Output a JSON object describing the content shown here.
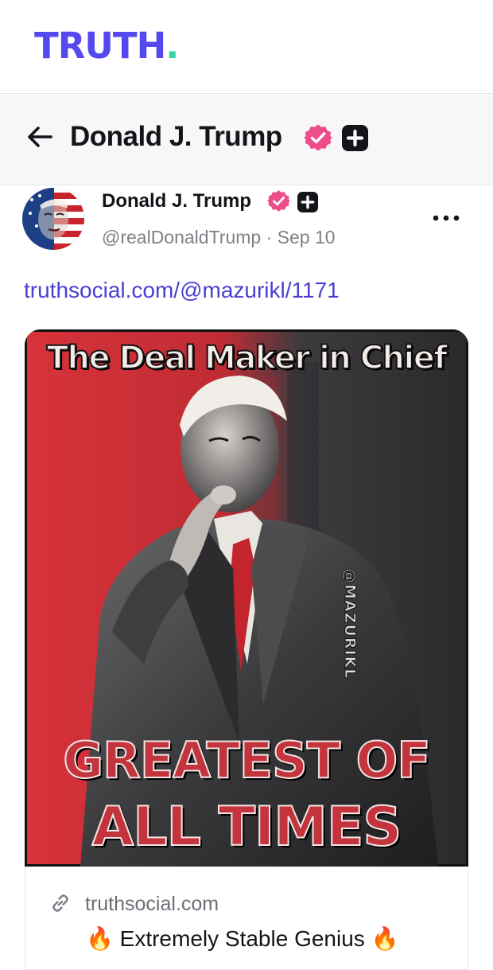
{
  "app": {
    "logo_text": "TRUTH",
    "logo_dot": ".",
    "brand_color": "#5448ee",
    "accent_color": "#36d3a8"
  },
  "header": {
    "back_icon": "arrow-left-icon",
    "title": "Donald J. Trump",
    "verified_icon": "verified-badge-icon",
    "plus_icon": "truth-plus-icon"
  },
  "post": {
    "author_name": "Donald J. Trump",
    "handle": "@realDonaldTrump",
    "separator": "·",
    "date": "Sep 10",
    "more_icon": "more-horizontal-icon",
    "link_text": "truthsocial.com/@mazurikl/1171",
    "link_color": "#4b3fd1",
    "image": {
      "title": "The Deal Maker in Chief",
      "watermark": "@MAZURIKL",
      "caption_line1": "GREATEST OF",
      "caption_line2": "ALL TIMES"
    },
    "card": {
      "link_icon": "link-icon",
      "domain": "truthsocial.com",
      "title": "🔥 Extremely Stable Genius 🔥"
    }
  },
  "colors": {
    "verified_pink": "#ee4d8c",
    "text_primary": "#14141a",
    "text_secondary": "#808088"
  }
}
